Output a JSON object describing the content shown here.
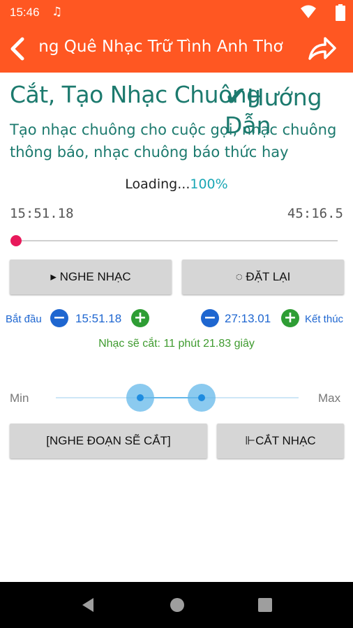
{
  "status": {
    "time": "15:46"
  },
  "appbar": {
    "title": " ng Quê Nhạc Trữ Tình Anh Thơ"
  },
  "heading": "Cắt, Tạo Nhạc Chuông",
  "guide": {
    "check": "✔",
    "label": "Hướng Dẫn"
  },
  "description": "Tạo nhạc chuông cho cuộc gọi, nhạc chuông thông báo, nhạc chuông báo thức hay",
  "loading": {
    "text": "Loading...",
    "percent": "100%"
  },
  "player": {
    "start_time": "15:51.18",
    "end_time": "45:16.5",
    "progress": 0.0
  },
  "buttons": {
    "play": "▸ NGHE NHẠC",
    "reset": "◌ ĐẶT LẠI",
    "preview": "[NGHE ĐOẠN SẼ CẮT]",
    "cut": "⊩CẮT NHẠC"
  },
  "trim": {
    "start_label": "Bắt đầu",
    "start_value": "15:51.18",
    "end_value": "27:13.01",
    "end_label": "Kết thúc",
    "minus": "−",
    "plus": "+"
  },
  "duration": "Nhạc sẽ cắt: 11 phút 21.83 giây",
  "range": {
    "min_label": "Min",
    "max_label": "Max",
    "low": 0.35,
    "high": 0.6
  },
  "colors": {
    "accent": "#ff5722",
    "heading": "#1c7a6e",
    "blue": "#1e66d0",
    "green": "#2e9d34",
    "seek": "#e8195b"
  }
}
